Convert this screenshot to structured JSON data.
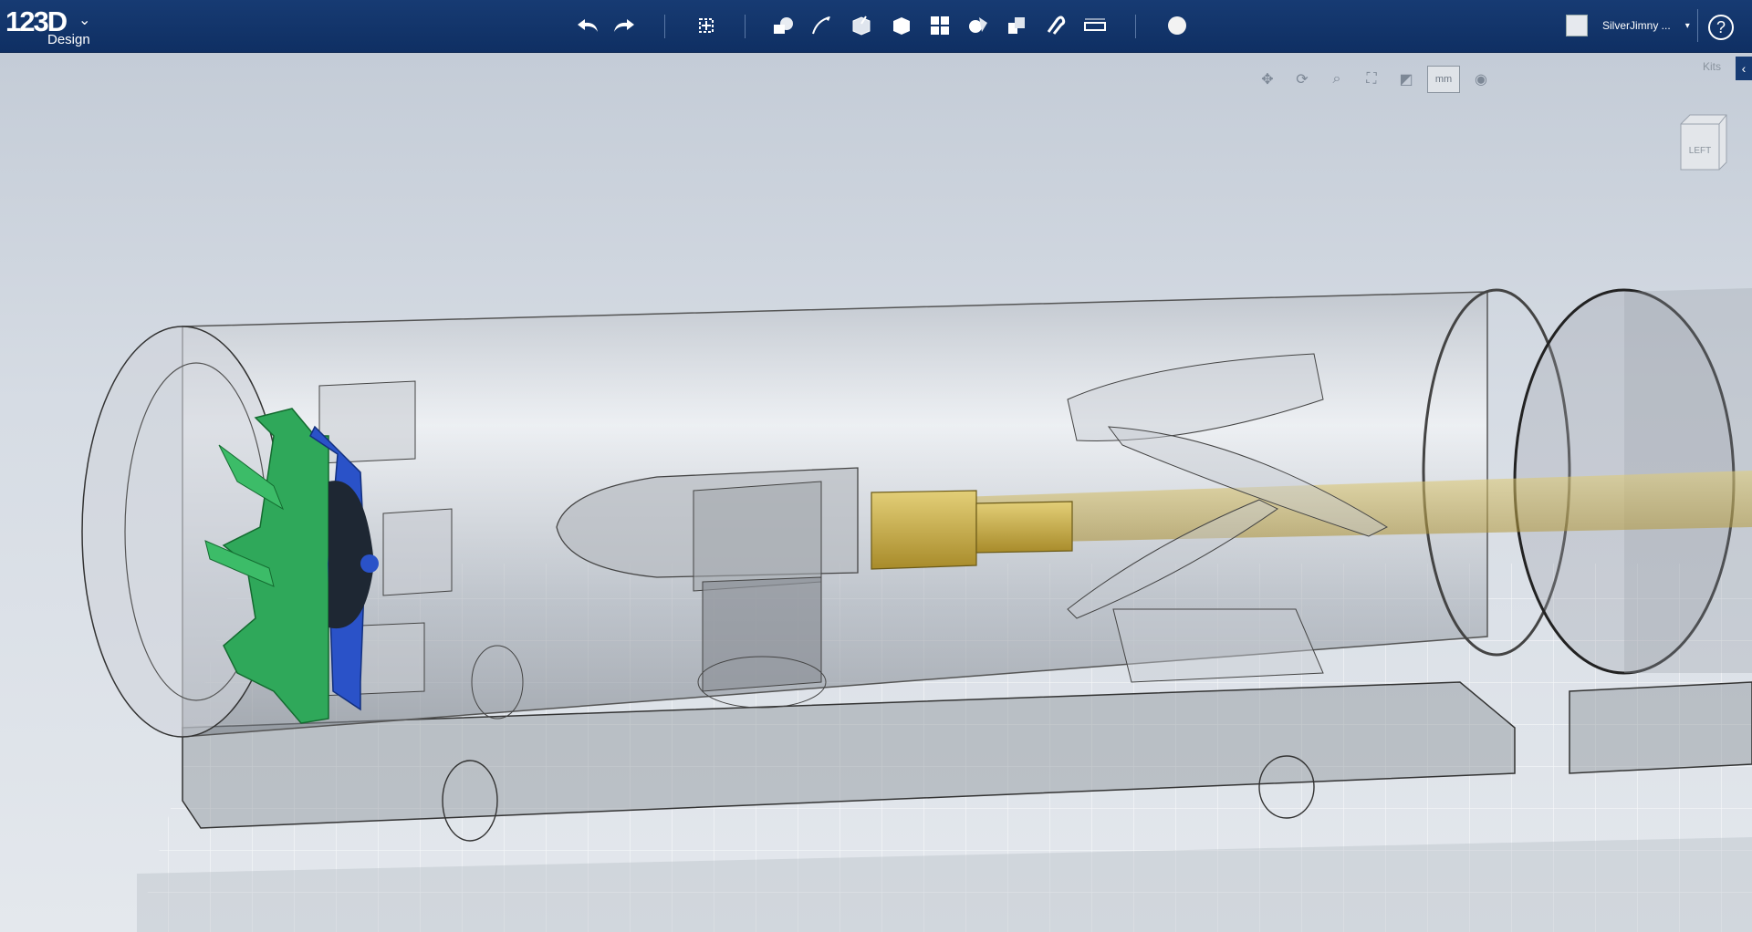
{
  "app": {
    "logo_text": "123D",
    "logo_sub": "Design"
  },
  "toolbar": {
    "buttons": [
      {
        "name": "undo",
        "icon": "undo-icon"
      },
      {
        "name": "redo",
        "icon": "redo-icon"
      },
      {
        "name": "transform",
        "icon": "transform-icon"
      },
      {
        "name": "primitives",
        "icon": "primitives-icon"
      },
      {
        "name": "sketch",
        "icon": "sketch-icon"
      },
      {
        "name": "construct",
        "icon": "construct-icon"
      },
      {
        "name": "modify",
        "icon": "modify-icon"
      },
      {
        "name": "pattern",
        "icon": "pattern-icon"
      },
      {
        "name": "grouping",
        "icon": "grouping-icon"
      },
      {
        "name": "combine",
        "icon": "combine-icon"
      },
      {
        "name": "snap",
        "icon": "snap-icon"
      },
      {
        "name": "measure",
        "icon": "measure-icon"
      },
      {
        "name": "material",
        "icon": "material-icon"
      }
    ]
  },
  "user": {
    "name": "SilverJimny ..."
  },
  "help": {
    "label": "?"
  },
  "nav": {
    "unit": "mm"
  },
  "kits": {
    "label": "Kits",
    "tab_glyph": "‹"
  },
  "viewcube": {
    "face": "LEFT"
  },
  "colors": {
    "topbar": "#173b73",
    "green": "#2fa85a",
    "blue": "#2a52c8",
    "brass": "#c9a93a"
  }
}
